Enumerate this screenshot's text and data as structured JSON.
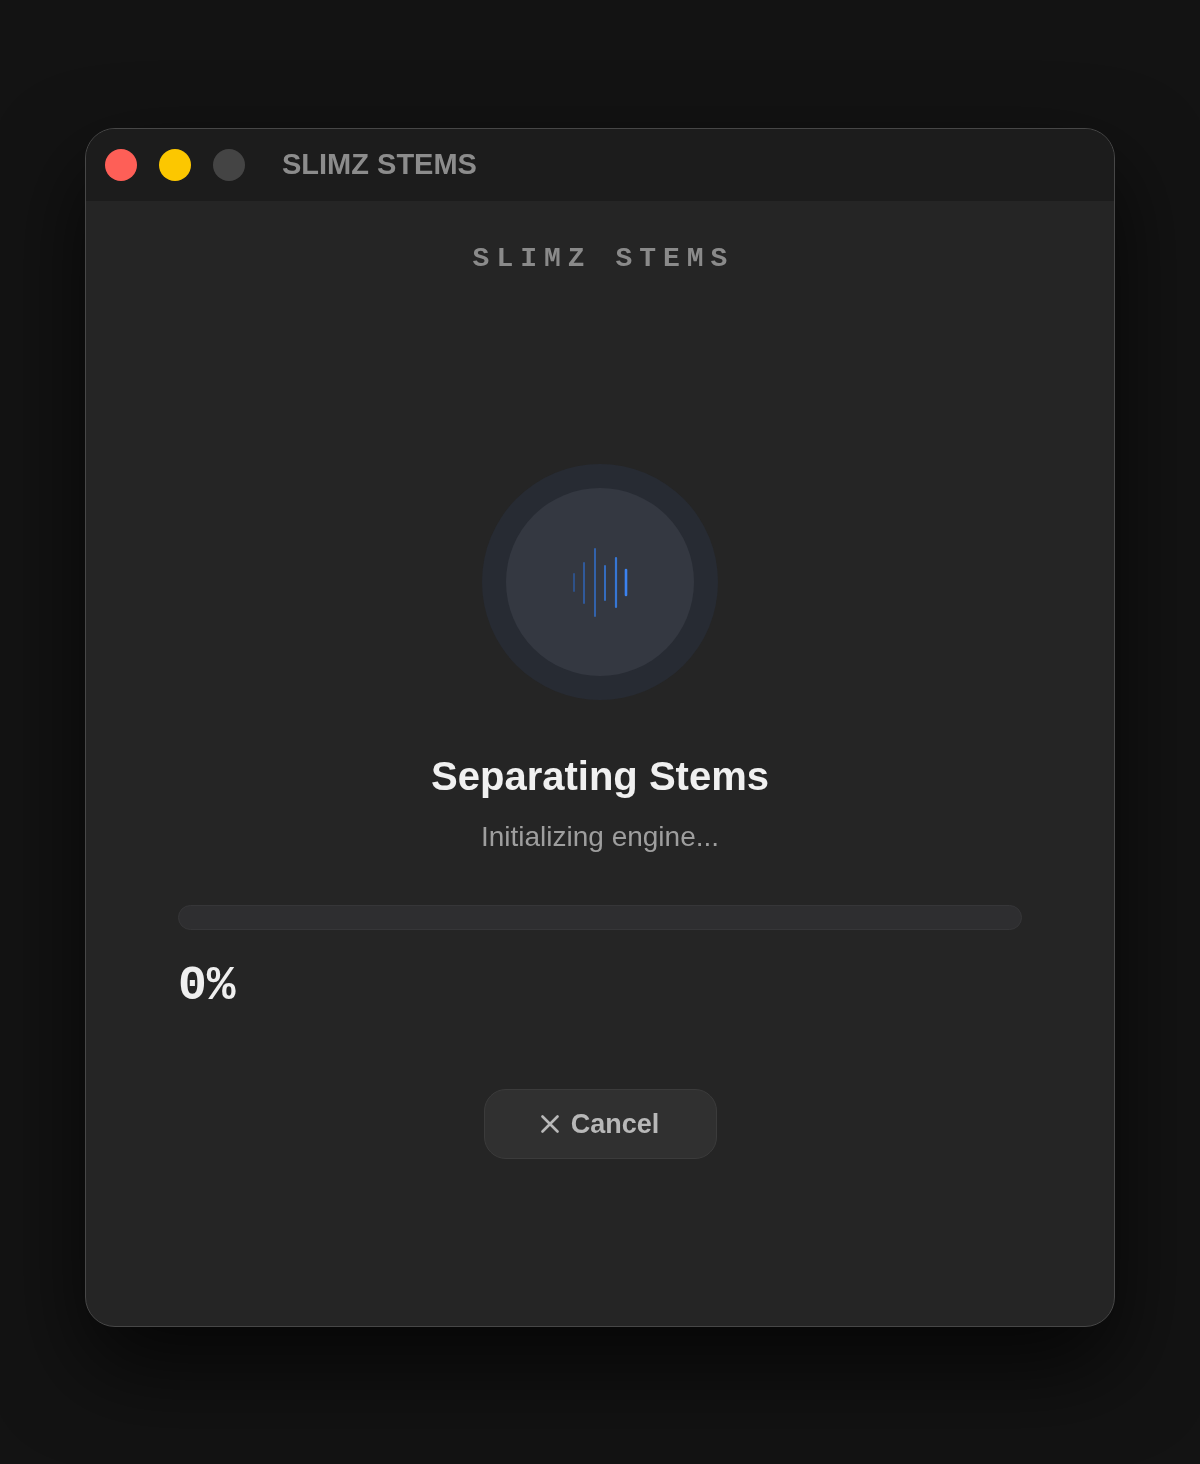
{
  "window": {
    "title": "SLIMZ STEMS",
    "controls": [
      {
        "kind": "close",
        "disabled": false
      },
      {
        "kind": "minimize",
        "disabled": false
      },
      {
        "kind": "maximize",
        "disabled": true
      }
    ]
  },
  "header": {
    "title": "SLIMZ STEMS"
  },
  "status": {
    "title": "Separating Stems",
    "message": "Initializing engine..."
  },
  "progress": {
    "level": 0,
    "reading": "0%"
  },
  "cancel_button": {
    "label": "Cancel"
  }
}
